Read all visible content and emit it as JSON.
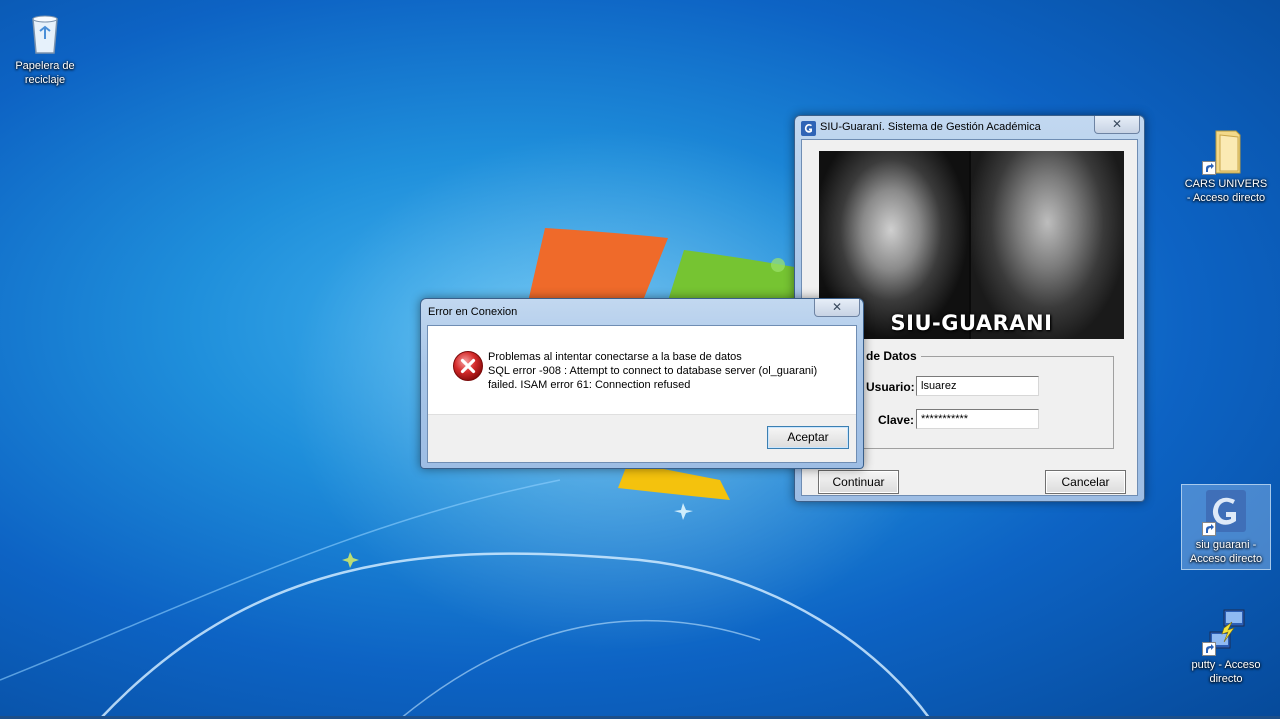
{
  "desktop": {
    "icons": [
      {
        "label": "Papelera de reciclaje",
        "icon": "recycle-bin-icon"
      },
      {
        "label": "CARS UNIVERS - Acceso directo",
        "icon": "folder-icon"
      },
      {
        "label": "siu guarani - Acceso directo",
        "icon": "siu-guarani-icon"
      },
      {
        "label": "putty - Acceso directo",
        "icon": "putty-icon"
      }
    ]
  },
  "siu_window": {
    "title": "SIU-Guaraní. Sistema de Gestión Académica",
    "close_label": "✕",
    "brand_text": "SIU-GUARANI",
    "group_title": "de Datos",
    "usuario_label": "Usuario:",
    "usuario_value": "lsuarez",
    "clave_label": "Clave:",
    "clave_value": "***********",
    "continuar_label": "Continuar",
    "cancelar_label": "Cancelar"
  },
  "error_dialog": {
    "title": "Error en Conexion",
    "close_label": "✕",
    "message_line1": "Problemas al intentar conectarse a la base de datos",
    "message_line2": "SQL error -908 : Attempt to connect to database server (ol_guarani)",
    "message_line3": "failed.  ISAM error 61: Connection refused",
    "accept_label": "Aceptar"
  },
  "colors": {
    "desktop_blue": "#1f8fdb",
    "window_frame": "#a9c6e8",
    "error_red": "#d42a2a"
  }
}
